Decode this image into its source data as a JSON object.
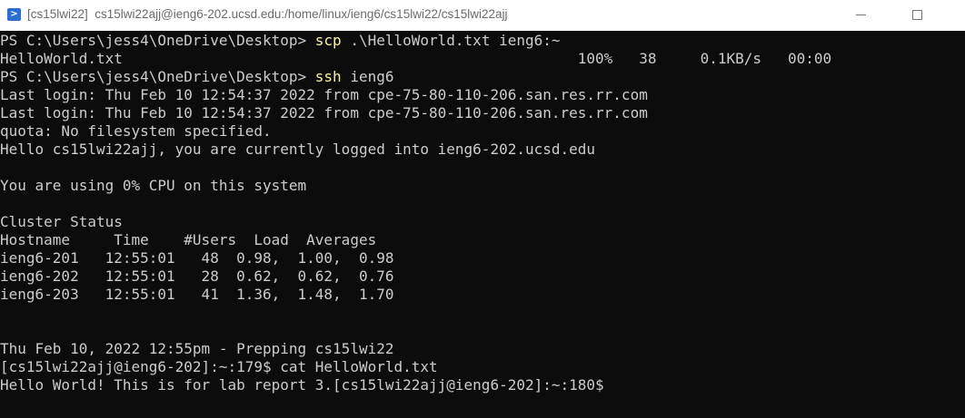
{
  "window": {
    "title": "[cs15lwi22]  cs15lwi22ajj@ieng6-202.ucsd.edu:/home/linux/ieng6/cs15lwi22/cs15lwi22ajj",
    "icon": "powershell-icon"
  },
  "terminal": {
    "prompt1": "PS C:\\Users\\jess4\\OneDrive\\Desktop> ",
    "cmd1": "scp",
    "args1": " .\\HelloWorld.txt ieng6:~",
    "transfer": "HelloWorld.txt                                                    100%   38     0.1KB/s   00:00",
    "prompt2": "PS C:\\Users\\jess4\\OneDrive\\Desktop> ",
    "cmd2": "ssh",
    "args2": " ieng6",
    "lines": [
      "Last login: Thu Feb 10 12:54:37 2022 from cpe-75-80-110-206.san.res.rr.com",
      "Last login: Thu Feb 10 12:54:37 2022 from cpe-75-80-110-206.san.res.rr.com",
      "quota: No filesystem specified.",
      "Hello cs15lwi22ajj, you are currently logged into ieng6-202.ucsd.edu",
      "",
      "You are using 0% CPU on this system",
      "",
      "Cluster Status",
      "Hostname     Time    #Users  Load  Averages",
      "ieng6-201   12:55:01   48  0.98,  1.00,  0.98",
      "ieng6-202   12:55:01   28  0.62,  0.62,  0.76",
      "ieng6-203   12:55:01   41  1.36,  1.48,  1.70",
      "",
      "",
      "Thu Feb 10, 2022 12:55pm - Prepping cs15lwi22",
      "[cs15lwi22ajj@ieng6-202]:~:179$ cat HelloWorld.txt",
      "Hello World! This is for lab report 3.[cs15lwi22ajj@ieng6-202]:~:180$"
    ]
  }
}
